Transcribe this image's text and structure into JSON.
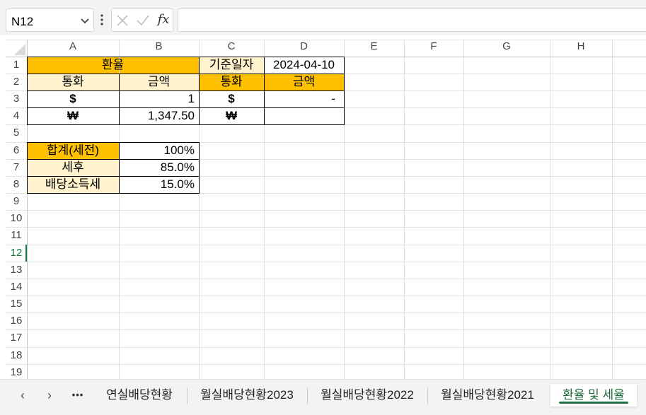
{
  "formula_bar": {
    "name_box": "N12",
    "fx_label": "fx",
    "formula": ""
  },
  "colors": {
    "header_orange": "#ffc000",
    "header_light": "#fff2cc",
    "selected_row": "#107c41",
    "tab_underline": "#1e7145",
    "gridline": "#e1e1e1"
  },
  "columns": [
    "A",
    "B",
    "C",
    "D",
    "E",
    "F",
    "G",
    "H"
  ],
  "rows": [
    "1",
    "2",
    "3",
    "4",
    "5",
    "6",
    "7",
    "8",
    "9",
    "10",
    "11",
    "12",
    "13",
    "14",
    "15",
    "16",
    "17",
    "18",
    "19"
  ],
  "selected_row": "12",
  "cells": {
    "a1": "환율",
    "c1": "기준일자",
    "d1": "2024-04-10",
    "a2": "통화",
    "b2": "금액",
    "c2": "통화",
    "d2": "금액",
    "a3": "$",
    "b3": "1",
    "c3": "$",
    "d3": "-",
    "a4": "₩",
    "b4": "1,347.50",
    "c4": "₩",
    "a6": "합계(세전)",
    "b6": "100%",
    "a7": "세후",
    "b7": "85.0%",
    "a8": "배당소득세",
    "b8": "15.0%"
  },
  "sheet_tabs": {
    "nav_prev": "‹",
    "nav_next": "›",
    "nav_more": "•••",
    "tabs": [
      "연실배당현황",
      "월실배당현황2023",
      "월실배당현황2022",
      "월실배당현황2021",
      "환율 및 세율"
    ],
    "active": "환율 및 세율"
  }
}
